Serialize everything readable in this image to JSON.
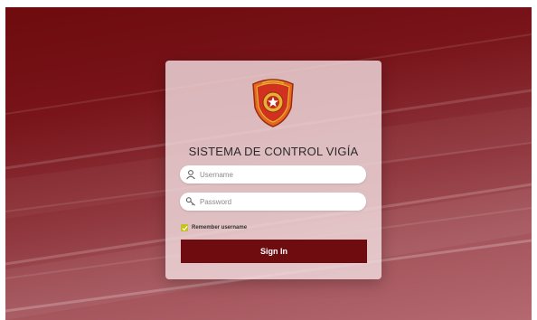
{
  "login": {
    "title": "SISTEMA DE CONTROL VIGÍA",
    "username_placeholder": "Username",
    "password_placeholder": "Password",
    "username_value": "",
    "password_value": "",
    "remember_label": "Remember username",
    "remember_checked": true,
    "signin_label": "Sign In"
  },
  "icons": {
    "emblem": "police-shield-emblem",
    "username": "user-icon",
    "password": "key-icon",
    "remember": "checkmark-icon"
  },
  "colors": {
    "background_dark": "#6e0b0d",
    "background_light": "#b46870",
    "button": "#6f0c10",
    "checkbox": "#c4c21d",
    "emblem_orange": "#e5661f",
    "emblem_gold": "#e3b234"
  }
}
